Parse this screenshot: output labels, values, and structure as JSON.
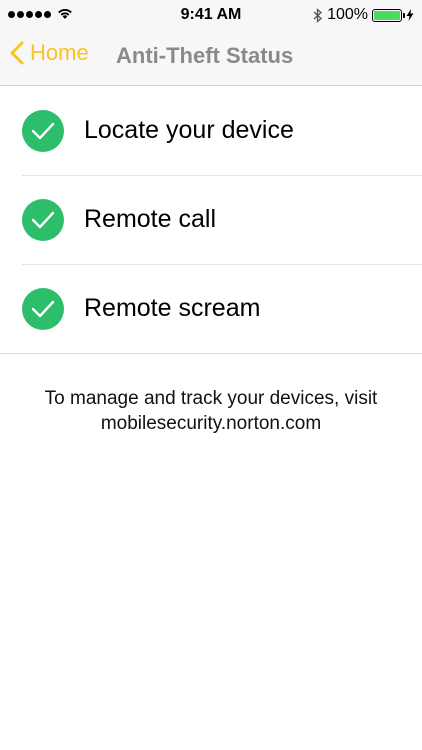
{
  "status_bar": {
    "time": "9:41 AM",
    "battery_percent": "100%",
    "battery_level": 1.0
  },
  "nav": {
    "back_label": "Home",
    "title": "Anti-Theft Status"
  },
  "features": [
    {
      "label": "Locate your device",
      "status_icon": "check-circle-icon"
    },
    {
      "label": "Remote call",
      "status_icon": "check-circle-icon"
    },
    {
      "label": "Remote scream",
      "status_icon": "check-circle-icon"
    }
  ],
  "note": {
    "line1": "To manage and track your devices, visit",
    "line2": "mobilesecurity.norton.com"
  },
  "colors": {
    "accent": "#f7c325",
    "success": "#2dbe6c",
    "battery": "#4cd964"
  }
}
